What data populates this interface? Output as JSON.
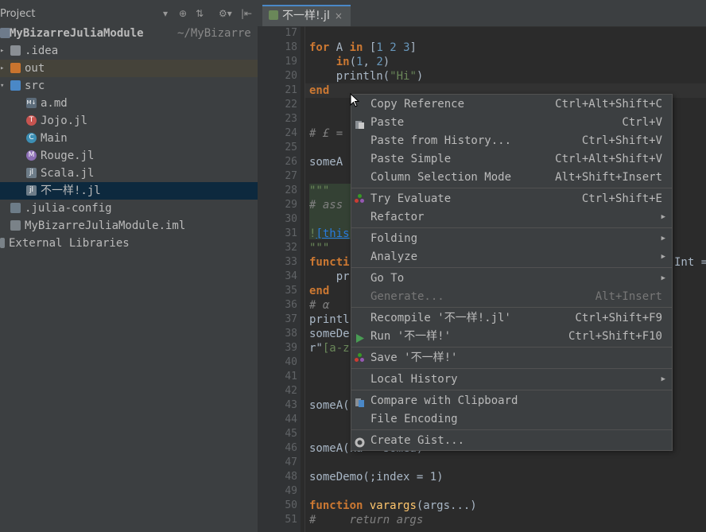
{
  "project": {
    "title": "Project",
    "controls": [
      "▾",
      "⊕",
      "⇅",
      "⚙▾",
      "|⇤"
    ],
    "root": {
      "name": "MyBizarreJuliaModule",
      "path": "~/MyBizarre"
    },
    "nodes": [
      {
        "label": ".idea",
        "kind": "folder"
      },
      {
        "label": "out",
        "kind": "folder-orange"
      },
      {
        "label": "src",
        "kind": "folder-blue"
      },
      {
        "label": "a.md",
        "kind": "md"
      },
      {
        "label": "Jojo.jl",
        "kind": "T"
      },
      {
        "label": "Main",
        "kind": "C"
      },
      {
        "label": "Rouge.jl",
        "kind": "M"
      },
      {
        "label": "Scala.jl",
        "kind": "jl"
      },
      {
        "label": "不一样!.jl",
        "kind": "jl"
      },
      {
        "label": ".julia-config",
        "kind": "cfg"
      },
      {
        "label": "MyBizarreJuliaModule.iml",
        "kind": "iml"
      },
      {
        "label": "External Libraries",
        "kind": "lib"
      }
    ]
  },
  "editor": {
    "tab_label": "不一样!.jl",
    "tab_close": "×",
    "line_numbers": [
      "17",
      "18",
      "19",
      "20",
      "21",
      "22",
      "23",
      "24",
      "25",
      "26",
      "27",
      "28",
      "29",
      "30",
      "31",
      "32",
      "33",
      "34",
      "35",
      "36",
      "37",
      "38",
      "39",
      "40",
      "41",
      "42",
      "43",
      "44",
      "45",
      "46",
      "47",
      "48",
      "49",
      "50",
      "51"
    ],
    "code": {
      "l18_kw": "for",
      "l18_var": " A ",
      "l18_in": "in",
      "l18_rest": " [",
      "l18_n1": "1",
      "l18_s1": " ",
      "l18_n2": "2",
      "l18_s2": " ",
      "l18_n3": "3",
      "l18_end": "]",
      "l19_pre": "    ",
      "l19_in": "in",
      "l19_a": "(",
      "l19_n1": "1",
      "l19_b": ", ",
      "l19_n2": "2",
      "l19_c": ")",
      "l20_pre": "    println(",
      "l20_str": "\"Hi\"",
      "l20_end": ")",
      "l21": "end",
      "l24": "# £ = ",
      "l26": "someA",
      "l28": "\"\"\"",
      "l29": "# ass",
      "l31_a": "!",
      "l31_link": "[this",
      "l32": "\"\"\"",
      "l33": "functi",
      "l33_right": "Int =",
      "l34": "    pr",
      "l35": "end",
      "l36": "# α",
      "l37": "printl",
      "l38": "someDe",
      "l39_a": "r\"",
      "l39_b": "[a-z",
      "l43": "someA(",
      "l46": "someA(ka = somea)",
      "l48": "someDemo(;index = 1)",
      "l50_kw": "function",
      "l50_fn": " varargs",
      "l50_rest": "(args...)",
      "l51": "#     return args"
    }
  },
  "menu": {
    "items": [
      {
        "label": "Copy Reference",
        "shortcut": "Ctrl+Alt+Shift+C"
      },
      {
        "label": "Paste",
        "shortcut": "Ctrl+V"
      },
      {
        "label": "Paste from History...",
        "shortcut": "Ctrl+Shift+V"
      },
      {
        "label": "Paste Simple",
        "shortcut": "Ctrl+Alt+Shift+V"
      },
      {
        "label": "Column Selection Mode",
        "shortcut": "Alt+Shift+Insert"
      },
      {
        "label": "Try Evaluate",
        "shortcut": "Ctrl+Shift+E"
      },
      {
        "label": "Refactor",
        "shortcut": ""
      },
      {
        "label": "Folding",
        "shortcut": ""
      },
      {
        "label": "Analyze",
        "shortcut": ""
      },
      {
        "label": "Go To",
        "shortcut": ""
      },
      {
        "label": "Generate...",
        "shortcut": "Alt+Insert"
      },
      {
        "label": "Recompile '不一样!.jl'",
        "shortcut": "Ctrl+Shift+F9"
      },
      {
        "label": "Run '不一样!'",
        "shortcut": "Ctrl+Shift+F10"
      },
      {
        "label": "Save '不一样!'",
        "shortcut": ""
      },
      {
        "label": "Local History",
        "shortcut": ""
      },
      {
        "label": "Compare with Clipboard",
        "shortcut": ""
      },
      {
        "label": "File Encoding",
        "shortcut": ""
      },
      {
        "label": "Create Gist...",
        "shortcut": ""
      }
    ],
    "submenu_arrow": "▶"
  },
  "colors": {
    "accent": "#4a88c7",
    "keyword": "#cc7832",
    "string": "#6a8759",
    "number": "#6897bb"
  }
}
